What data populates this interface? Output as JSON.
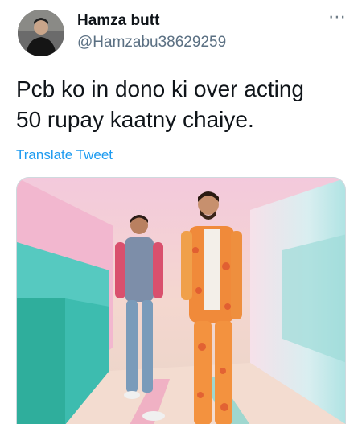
{
  "user": {
    "display_name": "Hamza butt",
    "handle": "@Hamzabu38629259"
  },
  "tweet": {
    "text": "Pcb ko in dono ki over acting\n50 rupay kaatny chaiye.",
    "translate_label": "Translate Tweet"
  },
  "icons": {
    "more": "more-options-icon"
  },
  "colors": {
    "name": "#0f1419",
    "handle": "#5b7083",
    "link": "#1d9bf0"
  }
}
